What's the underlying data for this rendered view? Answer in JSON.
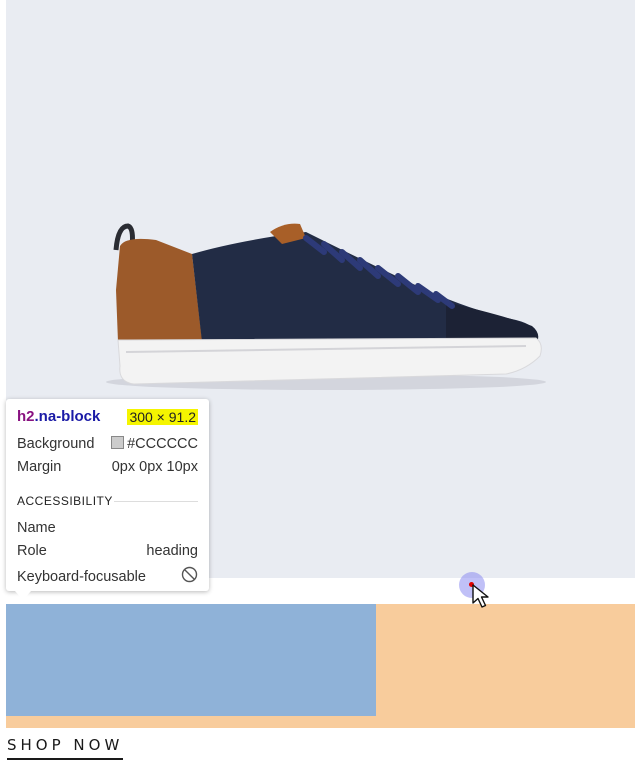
{
  "product": {
    "image_alt": "navy and tan leather sneaker"
  },
  "cta": {
    "label": "SHOP NOW"
  },
  "inspector": {
    "tag": "h2",
    "class": ".na-block",
    "size": "300 × 91.2",
    "background_label": "Background",
    "background_value": "#CCCCCC",
    "margin_label": "Margin",
    "margin_value": "0px 0px 10px",
    "accessibility_heading": "ACCESSIBILITY",
    "name_label": "Name",
    "name_value": "",
    "role_label": "Role",
    "role_value": "heading",
    "focusable_label": "Keyboard-focusable",
    "focusable_icon": "not-allowed-icon"
  },
  "colors": {
    "highlight_content": "#8fb2d8",
    "highlight_margin": "#f8cc9c",
    "swatch": "#cccccc"
  }
}
